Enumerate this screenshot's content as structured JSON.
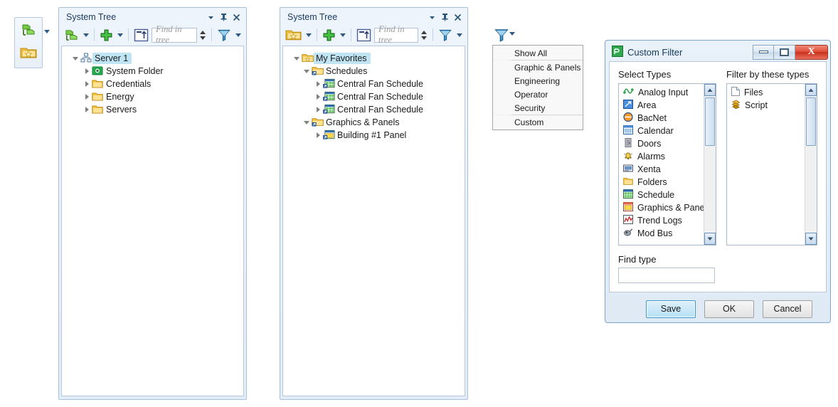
{
  "mini_toolbar": {
    "icons": [
      "system-tree-icon",
      "favorites-folder-icon"
    ],
    "dropdown": "▾"
  },
  "panels": [
    {
      "title": "System Tree",
      "toolbar": {
        "view_icon": "system-tree-icon",
        "add_icon": "add-plus-icon",
        "expand_icon": "expand-up-icon",
        "find_placeholder": "Find in tree",
        "filter_icon": "funnel-filter-icon"
      },
      "title_buttons": {
        "menu": "▾",
        "pin": "pin-icon",
        "close": "✕"
      },
      "tree": [
        {
          "label": "Server 1",
          "icon": "server-icon",
          "indent": 0,
          "state": "expanded",
          "selected": true
        },
        {
          "label": "System Folder",
          "icon": "system-folder-icon",
          "indent": 1,
          "state": "collapsed",
          "selected": false
        },
        {
          "label": "Credentials",
          "icon": "folder-icon",
          "indent": 1,
          "state": "collapsed",
          "selected": false
        },
        {
          "label": "Energy",
          "icon": "folder-icon",
          "indent": 1,
          "state": "collapsed",
          "selected": false
        },
        {
          "label": "Servers",
          "icon": "folder-icon",
          "indent": 1,
          "state": "collapsed",
          "selected": false
        }
      ]
    },
    {
      "title": "System Tree",
      "toolbar": {
        "view_icon": "favorites-folder-icon",
        "add_icon": "add-plus-icon",
        "expand_icon": "expand-up-icon",
        "find_placeholder": "Find in tree",
        "filter_icon": "funnel-filter-icon"
      },
      "title_buttons": {
        "menu": "▾",
        "pin": "pin-icon",
        "close": "✕"
      },
      "tree": [
        {
          "label": "My Favorites",
          "icon": "favorites-folder-icon",
          "indent": 0,
          "state": "expanded",
          "selected": true
        },
        {
          "label": "Schedules",
          "icon": "shortcut-folder-icon",
          "indent": 1,
          "state": "expanded",
          "selected": false
        },
        {
          "label": "Central Fan Schedule",
          "icon": "schedule-shortcut-icon",
          "indent": 2,
          "state": "collapsed",
          "selected": false
        },
        {
          "label": "Central Fan Schedule",
          "icon": "schedule-shortcut-icon",
          "indent": 2,
          "state": "collapsed",
          "selected": false
        },
        {
          "label": "Central Fan Schedule",
          "icon": "schedule-shortcut-icon",
          "indent": 2,
          "state": "collapsed",
          "selected": false
        },
        {
          "label": "Graphics & Panels",
          "icon": "shortcut-folder-icon",
          "indent": 1,
          "state": "expanded",
          "selected": false
        },
        {
          "label": "Building #1 Panel",
          "icon": "panel-shortcut-icon",
          "indent": 2,
          "state": "collapsed",
          "selected": false
        }
      ]
    }
  ],
  "filter_menu": {
    "trigger_icon": "funnel-filter-icon",
    "trigger_caret": "▾",
    "items": [
      {
        "label": "Show All",
        "separator_after": true
      },
      {
        "label": "Graphic & Panels",
        "separator_after": false
      },
      {
        "label": "Engineering",
        "separator_after": false
      },
      {
        "label": "Operator",
        "separator_after": false
      },
      {
        "label": "Security",
        "separator_after": true
      },
      {
        "label": "Custom",
        "separator_after": false
      }
    ]
  },
  "dialog": {
    "title": "Custom Filter",
    "title_icon": "custom-filter-icon",
    "window_buttons": {
      "minimize": "minimize-icon",
      "maximize": "maximize-icon",
      "close": "X"
    },
    "left_column": {
      "header": "Select Types",
      "items": [
        {
          "label": "Analog Input",
          "icon": "analog-input-icon"
        },
        {
          "label": "Area",
          "icon": "area-icon"
        },
        {
          "label": "BacNet",
          "icon": "bacnet-icon"
        },
        {
          "label": "Calendar",
          "icon": "calendar-icon"
        },
        {
          "label": "Doors",
          "icon": "doors-icon"
        },
        {
          "label": "Alarms",
          "icon": "alarms-bell-icon"
        },
        {
          "label": "Xenta",
          "icon": "xenta-icon"
        },
        {
          "label": "Folders",
          "icon": "folder-icon"
        },
        {
          "label": "Schedule",
          "icon": "schedule-icon"
        },
        {
          "label": "Graphics & Panels",
          "icon": "graphics-panels-icon"
        },
        {
          "label": "Trend Logs",
          "icon": "trend-logs-icon"
        },
        {
          "label": "Mod Bus",
          "icon": "mod-bus-icon"
        }
      ]
    },
    "right_column": {
      "header": "Filter by these types",
      "items": [
        {
          "label": "Files",
          "icon": "file-icon"
        },
        {
          "label": "Script",
          "icon": "script-icon"
        }
      ]
    },
    "find_type": {
      "label": "Find type",
      "value": "",
      "placeholder": ""
    },
    "buttons": {
      "save": "Save",
      "ok": "OK",
      "cancel": "Cancel"
    }
  },
  "colors": {
    "selection": "#bfe4f4",
    "panel_border": "#a8c0dc",
    "title_text": "#1c3d63",
    "close_red": "#c9301b",
    "primary_button": "#b7e0f5"
  }
}
